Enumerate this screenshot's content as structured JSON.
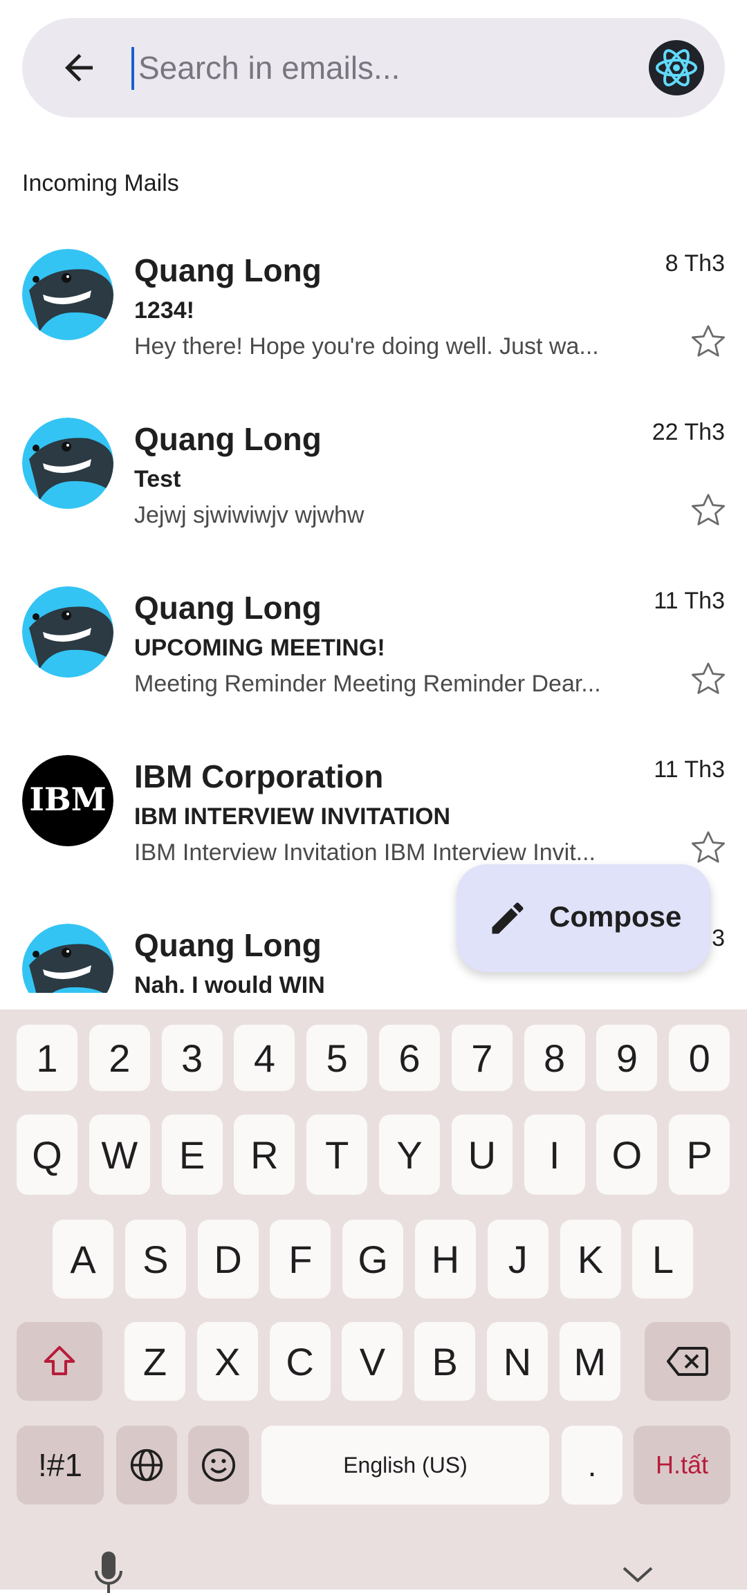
{
  "search": {
    "placeholder": "Search in emails..."
  },
  "section_title": "Incoming Mails",
  "mails": [
    {
      "sender": "Quang Long",
      "subject": "1234!",
      "preview": "Hey there! Hope you're doing well. Just wa...",
      "date": "8 Th3",
      "avatar": "whale-avatar"
    },
    {
      "sender": "Quang Long",
      "subject": "Test",
      "preview": "Jejwj sjwiwiwjv wjwhw",
      "date": "22 Th3",
      "avatar": "whale-avatar"
    },
    {
      "sender": "Quang Long",
      "subject": "UPCOMING MEETING!",
      "preview": "Meeting Reminder Meeting Reminder Dear...",
      "date": "11 Th3",
      "avatar": "whale-avatar"
    },
    {
      "sender": "IBM Corporation",
      "subject": "IBM INTERVIEW INVITATION",
      "preview": "IBM Interview Invitation IBM Interview Invit...",
      "date": "11 Th3",
      "avatar": "ibm-logo",
      "logo_text": "IBM"
    },
    {
      "sender": "Quang Long",
      "subject": "Nah, I would WIN",
      "preview": "",
      "date": "3",
      "avatar": "whale-avatar"
    }
  ],
  "compose": {
    "label": "Compose"
  },
  "keyboard": {
    "row_numbers": [
      "1",
      "2",
      "3",
      "4",
      "5",
      "6",
      "7",
      "8",
      "9",
      "0"
    ],
    "row_q": [
      "Q",
      "W",
      "E",
      "R",
      "T",
      "Y",
      "U",
      "I",
      "O",
      "P"
    ],
    "row_a": [
      "A",
      "S",
      "D",
      "F",
      "G",
      "H",
      "J",
      "K",
      "L"
    ],
    "row_z": [
      "Z",
      "X",
      "C",
      "V",
      "B",
      "N",
      "M"
    ],
    "symbols_key": "!#1",
    "space_label": "English (US)",
    "period_key": ".",
    "action_key": "H.tất"
  },
  "colors": {
    "accent": "#1a5fd1",
    "whale_blue": "#33c4f4",
    "whale_dark": "#2b3a43",
    "fab_bg": "#dfe2f8",
    "keyboard_bg": "#e9dfdf"
  }
}
